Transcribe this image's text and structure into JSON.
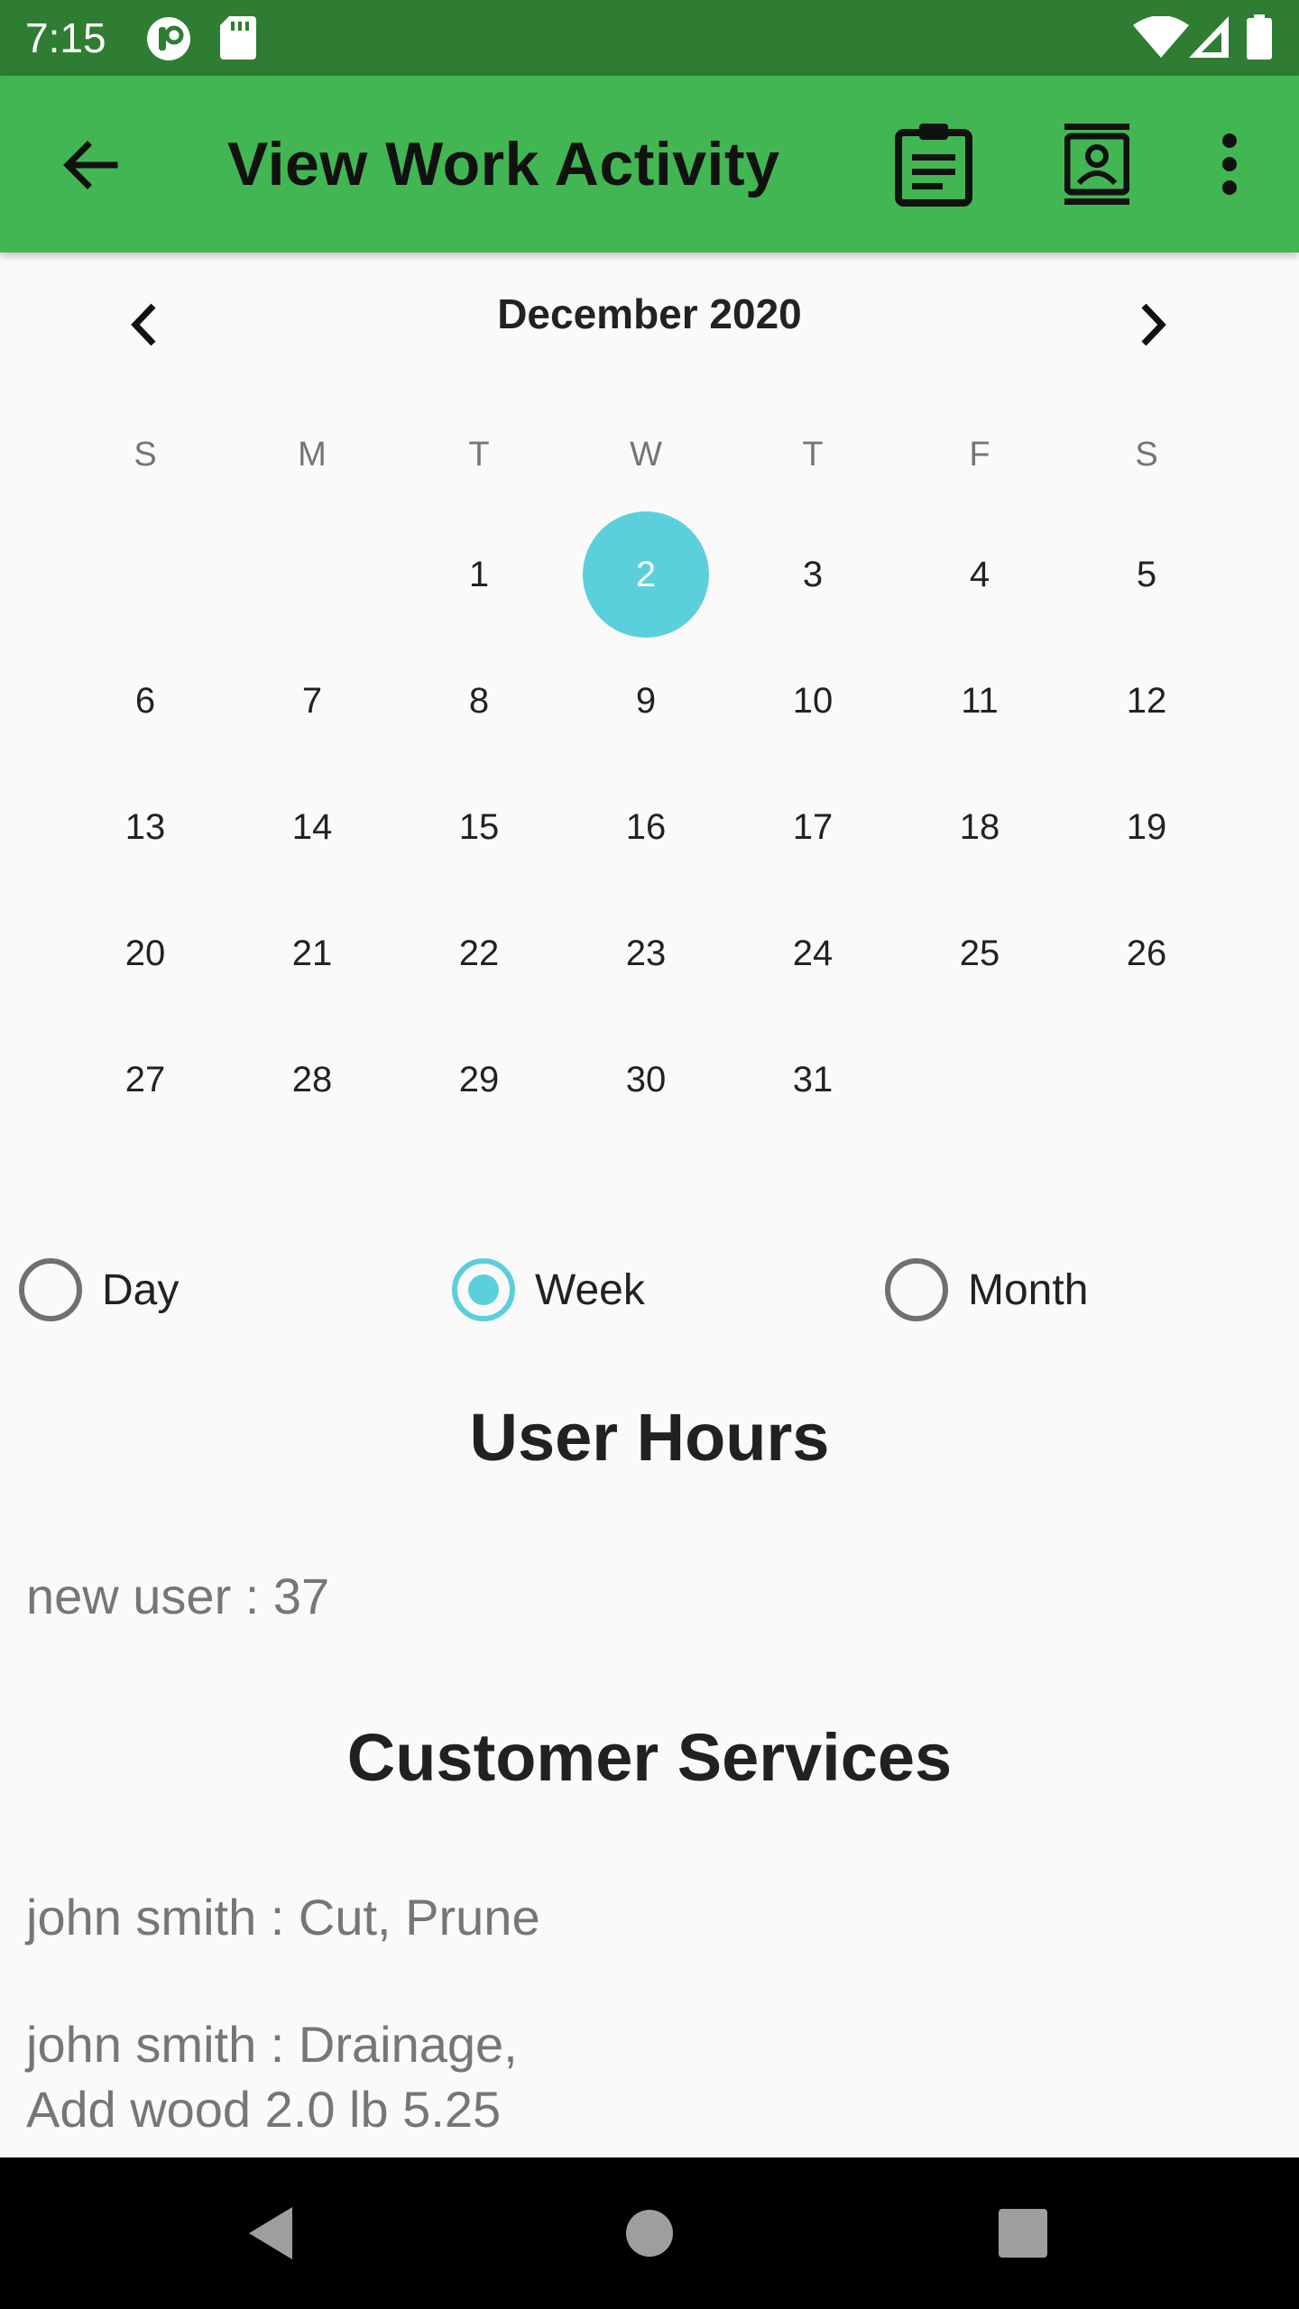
{
  "status_bar": {
    "time": "7:15",
    "icons": [
      "notification-app-icon",
      "sd-card-icon",
      "wifi-icon",
      "cell-signal-icon",
      "battery-icon"
    ]
  },
  "app_bar": {
    "title": "View Work Activity",
    "background": "#42b653",
    "icons": [
      "back-arrow-icon",
      "clipboard-icon",
      "contact-card-icon",
      "overflow-menu-icon"
    ]
  },
  "calendar": {
    "month_label": "December 2020",
    "prev_icon": "chevron-left-icon",
    "next_icon": "chevron-right-icon",
    "weekdays": [
      "S",
      "M",
      "T",
      "W",
      "T",
      "F",
      "S"
    ],
    "days": [
      "1",
      "2",
      "3",
      "4",
      "5",
      "6",
      "7",
      "8",
      "9",
      "10",
      "11",
      "12",
      "13",
      "14",
      "15",
      "16",
      "17",
      "18",
      "19",
      "20",
      "21",
      "22",
      "23",
      "24",
      "25",
      "26",
      "27",
      "28",
      "29",
      "30",
      "31"
    ],
    "selected_day": "2",
    "selected_color": "#5bcfdb"
  },
  "range_options": [
    {
      "label": "Day",
      "checked": false
    },
    {
      "label": "Week",
      "checked": true
    },
    {
      "label": "Month",
      "checked": false
    }
  ],
  "user_hours": {
    "heading": "User Hours",
    "items": [
      "new user : 37"
    ]
  },
  "customer_services": {
    "heading": "Customer Services",
    "items": [
      "john smith : Cut, Prune",
      "john smith : Drainage,\nAdd wood 2.0 lb 5.25"
    ]
  },
  "nav_bar": {
    "icons": [
      "back-triangle-icon",
      "home-circle-icon",
      "recents-square-icon"
    ]
  }
}
